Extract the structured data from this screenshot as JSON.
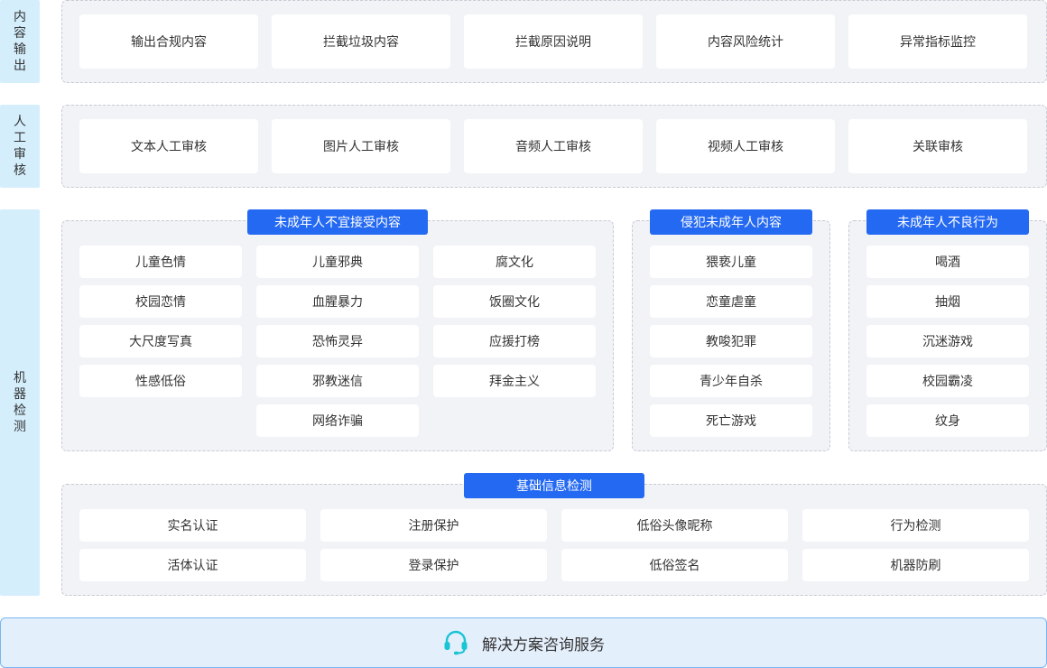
{
  "sections": {
    "output": {
      "side_label": "内容输出",
      "items": [
        "输出合规内容",
        "拦截垃圾内容",
        "拦截原因说明",
        "内容风险统计",
        "异常指标监控"
      ]
    },
    "manual": {
      "side_label": "人工审核",
      "items": [
        "文本人工审核",
        "图片人工审核",
        "音频人工审核",
        "视频人工审核",
        "关联审核"
      ]
    },
    "machine": {
      "side_label": "机器检测",
      "minors_unsuitable": {
        "title": "未成年人不宜接受内容",
        "col1": [
          "儿童色情",
          "校园恋情",
          "大尺度写真",
          "性感低俗"
        ],
        "col2": [
          "儿童邪典",
          "血腥暴力",
          "恐怖灵异",
          "邪教迷信",
          "网络诈骗"
        ],
        "col3": [
          "腐文化",
          "饭圈文化",
          "应援打榜",
          "拜金主义"
        ]
      },
      "minors_infringement": {
        "title": "侵犯未成年人内容",
        "items": [
          "猥亵儿童",
          "恋童虐童",
          "教唆犯罪",
          "青少年自杀",
          "死亡游戏"
        ]
      },
      "minors_behavior": {
        "title": "未成年人不良行为",
        "items": [
          "喝酒",
          "抽烟",
          "沉迷游戏",
          "校园霸凌",
          "纹身"
        ]
      },
      "basic": {
        "title": "基础信息检测",
        "row1": [
          "实名认证",
          "注册保护",
          "低俗头像昵称",
          "行为检测"
        ],
        "row2": [
          "活体认证",
          "登录保护",
          "低俗签名",
          "机器防刷"
        ]
      }
    }
  },
  "consult_button": {
    "icon": "headset-icon",
    "label": "解决方案咨询服务"
  },
  "colors": {
    "accent": "#2469f2",
    "side_bg": "#d4eefc",
    "panel_bg": "#f2f3f7",
    "consult_bg": "#e4effc",
    "icon": "#19c4d4"
  }
}
